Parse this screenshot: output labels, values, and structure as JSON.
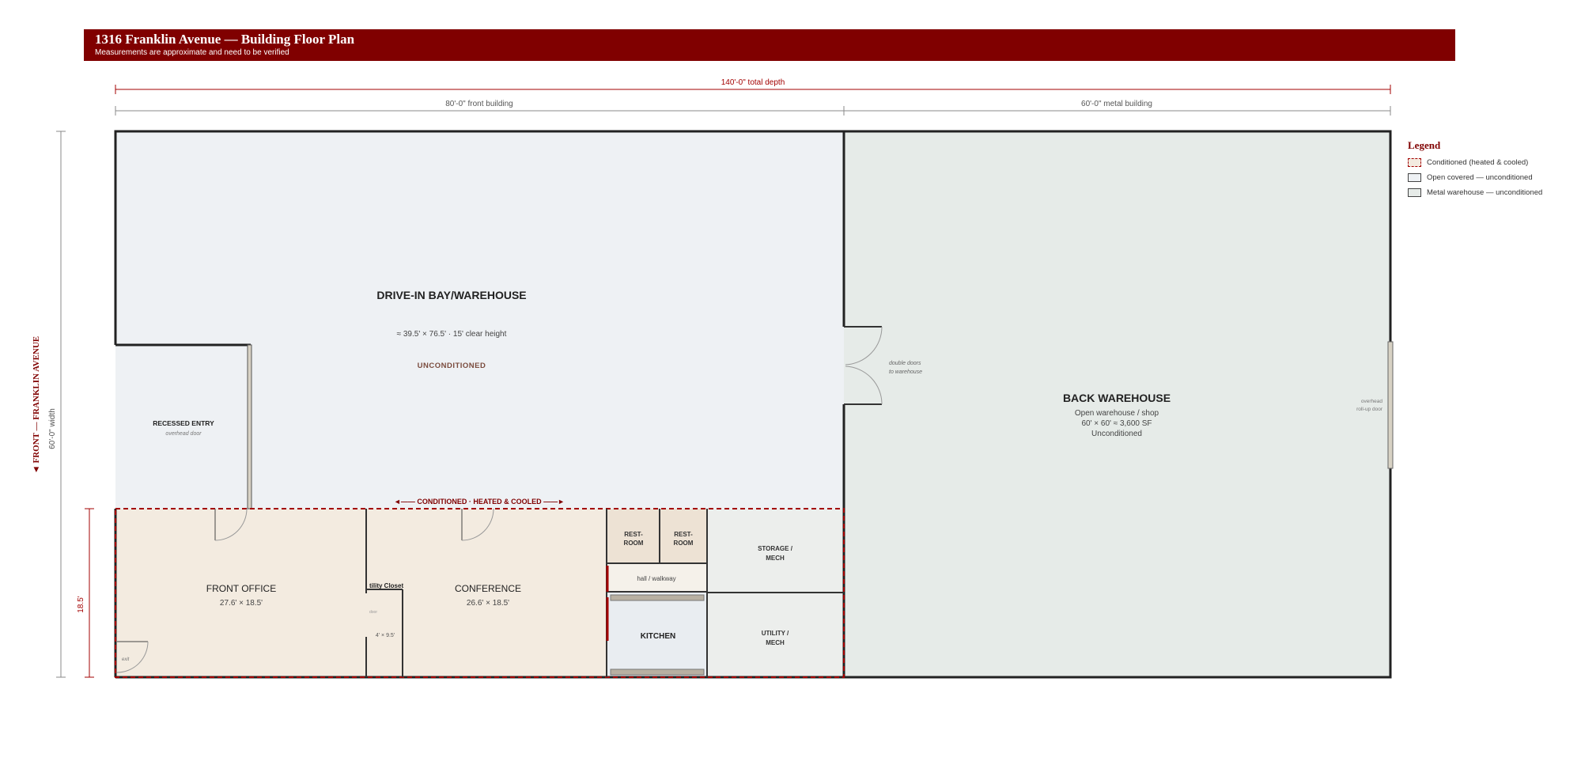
{
  "header": {
    "title": "1316 Franklin Avenue — Building Floor Plan",
    "subtitle": "Measurements are approximate and need to be verified"
  },
  "dimensions": {
    "total": "140'-0\" total depth",
    "front_building": "80'-0\" front building",
    "metal_building": "60'-0\" metal building",
    "width": "60'-0\" width",
    "conditioned_depth": "18.5'",
    "front_street": "◄ FRONT — FRANKLIN AVENUE"
  },
  "rooms": {
    "drive_in": {
      "name": "DRIVE-IN BAY/WAREHOUSE",
      "size": "≈ 39.5' × 76.5'  ·  15' clear height",
      "status": "UNCONDITIONED"
    },
    "recessed_entry": {
      "name": "RECESSED ENTRY",
      "note": "overhead door"
    },
    "back_warehouse": {
      "name": "BACK WAREHOUSE",
      "line1": "Open warehouse / shop",
      "line2": "60' × 60' ≈ 3,600 SF",
      "line3": "Unconditioned"
    },
    "front_office": {
      "name": "FRONT OFFICE",
      "size": "27.6' × 18.5'"
    },
    "conference": {
      "name": "CONFERENCE",
      "size": "26.6' × 18.5'"
    },
    "utility_closet": {
      "name": "tility Closet",
      "door": "door",
      "size": "4' × 9.5'"
    },
    "restroom_1": {
      "line1": "REST-",
      "line2": "ROOM"
    },
    "restroom_2": {
      "line1": "REST-",
      "line2": "ROOM"
    },
    "hall": {
      "name": "hall / walkway"
    },
    "kitchen": {
      "name": "KITCHEN"
    },
    "storage": {
      "line1": "STORAGE /",
      "line2": "MECH"
    },
    "utility": {
      "line1": "UTILITY /",
      "line2": "MECH"
    },
    "exit_label": "exit"
  },
  "annotations": {
    "conditioned_band": "◄—— CONDITIONED · HEATED & COOLED ——►",
    "double_doors_1": "double doors",
    "double_doors_2": "to warehouse",
    "overhead_1": "overhead",
    "overhead_2": "roll-up door"
  },
  "legend": {
    "title": "Legend",
    "items": [
      {
        "label": "Conditioned (heated & cooled)"
      },
      {
        "label": "Open covered — unconditioned"
      },
      {
        "label": "Metal warehouse — unconditioned"
      }
    ]
  },
  "colors": {
    "brand": "#800000",
    "conditioned_fill": "#f3ebe0",
    "conditioned_border": "#a30000",
    "open_fill": "#eef1f4",
    "metal_fill": "#e6ebe8",
    "kitchen_fill": "#e9edf1",
    "wall": "#222222"
  }
}
